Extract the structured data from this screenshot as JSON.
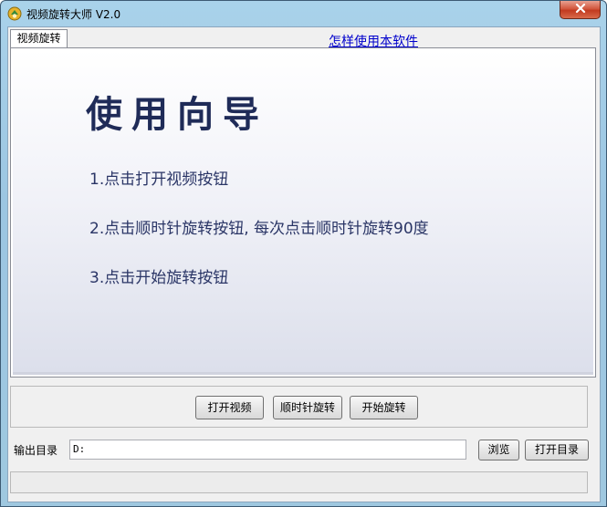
{
  "window": {
    "title": "视频旋转大师 V2.0"
  },
  "tabs": [
    {
      "label": "视频旋转"
    }
  ],
  "help_link": "怎样使用本软件",
  "guide": {
    "title": "使用向导",
    "steps": [
      "1.点击打开视频按钮",
      "2.点击顺时针旋转按钮, 每次点击顺时针旋转90度",
      "3.点击开始旋转按钮"
    ]
  },
  "actions": {
    "open_video": "打开视频",
    "rotate_cw": "顺时针旋转",
    "start_rotate": "开始旋转"
  },
  "output": {
    "label": "输出目录",
    "value": "D:",
    "browse": "浏览",
    "open_dir": "打开目录"
  },
  "colors": {
    "accent": "#1f2b58",
    "link": "#0000cc",
    "close_button": "#c23a20"
  },
  "icons": {
    "app": "app-logo-icon",
    "close": "close-icon"
  }
}
